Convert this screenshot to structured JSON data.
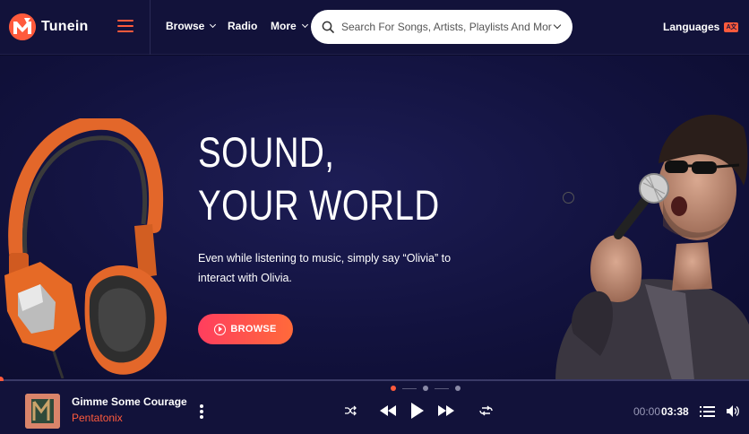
{
  "header": {
    "brand_name": "Tunein",
    "nav": {
      "browse": "Browse",
      "radio": "Radio",
      "more": "More"
    },
    "search_placeholder": "Search For Songs, Artists, Playlists And More..",
    "languages_label": "Languages",
    "languages_badge": "A文"
  },
  "hero": {
    "title_line1": "SOUND,",
    "title_line2": "YOUR WORLD",
    "description": "Even while listening to music, simply say “Olivia” to interact with Olivia.",
    "button_label": "BROWSE",
    "slides_count": 3,
    "active_slide": 1
  },
  "player": {
    "track_title": "Gimme Some Courage",
    "artist": "Pentatonix",
    "current_time": "00:00",
    "total_time": "03:38",
    "progress_fraction": 0.0
  },
  "colors": {
    "accent": "#ff5a3c",
    "background": "#0b0b2a",
    "panel": "#12123a"
  },
  "icons": [
    "brand-logo-icon",
    "menu-icon",
    "chevron-down-icon",
    "search-icon",
    "language-icon",
    "play-circle-icon",
    "more-vertical-icon",
    "shuffle-icon",
    "rewind-icon",
    "play-icon",
    "fast-forward-icon",
    "repeat-icon",
    "queue-list-icon",
    "volume-icon"
  ]
}
